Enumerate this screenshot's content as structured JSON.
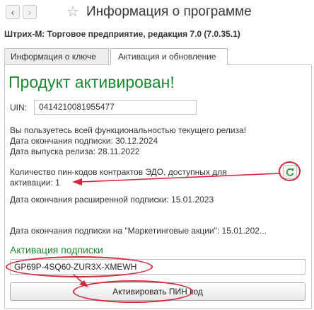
{
  "window": {
    "back_icon": "‹",
    "forward_icon": "›",
    "favorite_icon": "☆",
    "title": "Информация о программе"
  },
  "subtitle": "Штрих-М: Торговое предприятие, редакция 7.0 (7.0.35.1)",
  "tabs": [
    {
      "label": "Информация о ключе",
      "active": false
    },
    {
      "label": "Активация и обновление",
      "active": true
    }
  ],
  "main": {
    "heading": "Продукт активирован!",
    "uin_label": "UIN:",
    "uin_value": "0414210081955477",
    "lines": [
      "Вы пользуетесь всей функциональностью текущего релиза!",
      "Дата окончания подписки: 30.12.2024",
      "Дата выпуска релиза: 28.11.2022"
    ],
    "pin_count_line1": "Количество пин-кодов контрактов ЭДО, доступных для",
    "pin_count_line2": "активации: 1",
    "extended_subscription": "Дата окончания расширенной подписки:  15.01.2023",
    "marketing_subscription": "Дата окончания подписки на \"Маркетинговые акции\": 15.01.202..."
  },
  "activation": {
    "section_title": "Активация подписки",
    "code_value": "GP69P-4SQ60-ZUR3X-XMEWH",
    "button_label": "Активировать ПИН код"
  },
  "colors": {
    "accent_green": "#1b8a2f",
    "highlight_red": "#d6263b"
  }
}
